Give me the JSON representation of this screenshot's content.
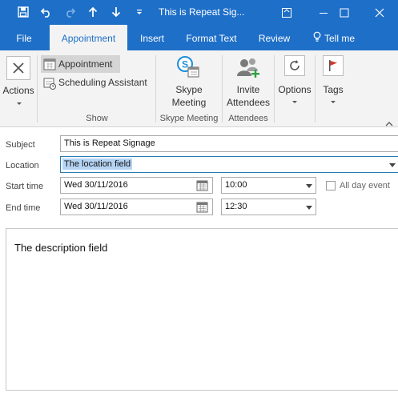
{
  "window": {
    "title": "This is Repeat Sig...",
    "minimize_icon": "minimize-icon",
    "maximize_icon": "maximize-icon",
    "close_icon": "close-icon"
  },
  "quick_access": [
    "save-icon",
    "undo-icon",
    "redo-icon",
    "previous-item-icon",
    "next-item-icon",
    "customize-qat-icon"
  ],
  "tabs": [
    {
      "label": "File"
    },
    {
      "label": "Appointment"
    },
    {
      "label": "Insert"
    },
    {
      "label": "Format Text"
    },
    {
      "label": "Review"
    },
    {
      "label": "Tell me"
    }
  ],
  "ribbon": {
    "actions_label": "Actions",
    "appointment_label": "Appointment",
    "scheduling_label": "Scheduling Assistant",
    "show_group": "Show",
    "skype_line1": "Skype",
    "skype_line2": "Meeting",
    "skype_group": "Skype Meeting",
    "invite_line1": "Invite",
    "invite_line2": "Attendees",
    "attendees_group": "Attendees",
    "options_label": "Options",
    "tags_label": "Tags"
  },
  "form": {
    "subject_label": "Subject",
    "subject_value": "This is Repeat Signage",
    "location_label": "Location",
    "location_value": "The location field",
    "start_label": "Start time",
    "start_date": "Wed 30/11/2016",
    "start_time": "10:00",
    "allday_label": "All day event",
    "allday_checked": false,
    "end_label": "End time",
    "end_date": "Wed 30/11/2016",
    "end_time": "12:30",
    "description": "The description field"
  },
  "colors": {
    "accent": "#1e6fc8",
    "selection": "#b5d4f4"
  }
}
